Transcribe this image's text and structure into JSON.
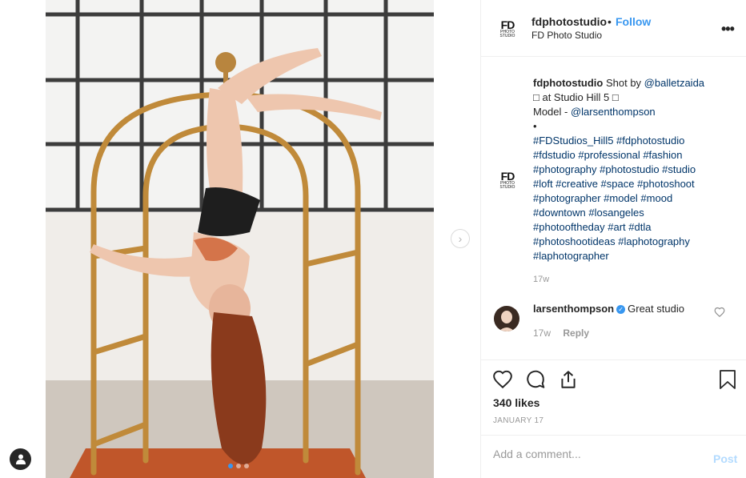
{
  "post": {
    "username": "fdphotostudio",
    "follow_label": "Follow",
    "separator": "•",
    "location": "FD Photo Studio",
    "more": "•••",
    "logo_text": "FD",
    "logo_sub": "PHOTO STUDIO"
  },
  "caption": {
    "username": "fdphotostudio",
    "line1_text": " Shot by ",
    "line1_mention": "@balletzaida",
    "line2": "□ at Studio Hill 5 □",
    "line3_text": "Model - ",
    "line3_mention": "@larsenthompson",
    "line4": "•",
    "hashtag_lines": [
      "#FDStudios_Hill5 #fdphotostudio",
      "#fdstudio #professional #fashion",
      "#photography #photostudio #studio",
      "#loft #creative #space #photoshoot",
      "#photographer #model #mood",
      "#downtown #losangeles",
      "#photooftheday #art #dtla",
      "#photoshootideas #laphotography",
      "#laphotographer"
    ],
    "time": "17w"
  },
  "comment": {
    "username": "larsenthompson",
    "verified_glyph": "✓",
    "text": "Great studio",
    "time": "17w",
    "reply_label": "Reply"
  },
  "stats": {
    "likes": "340 likes",
    "date": "JANUARY 17"
  },
  "add_comment": {
    "placeholder": "Add a comment...",
    "post_label": "Post"
  },
  "carousel": {
    "next_glyph": "›",
    "slide_count": 3,
    "active_slide": 1
  },
  "colors": {
    "accent": "#3897f0",
    "link": "#003569",
    "muted": "#999999",
    "post_disabled": "#b3dbff"
  }
}
